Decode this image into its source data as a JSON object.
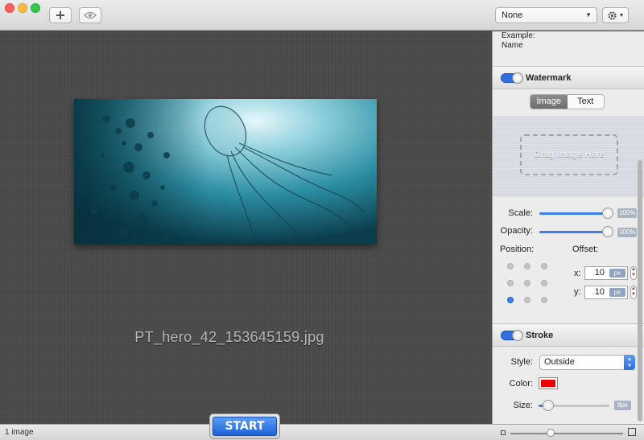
{
  "toolbar": {
    "preset_select": "None",
    "add_icon": "plus-icon",
    "preview_icon": "eye-icon",
    "settings_icon": "gear-icon"
  },
  "canvas": {
    "filename": "PT_hero_42_153645159.jpg"
  },
  "statusbar": {
    "image_count": "1 image",
    "start_label": "START"
  },
  "panel": {
    "top_text_line1": "Example:",
    "top_text_line2": "Name",
    "watermark": {
      "title": "Watermark",
      "enabled": true,
      "tab_image": "Image",
      "tab_text": "Text",
      "drop_hint": "Drag Image Here",
      "scale_label": "Scale:",
      "scale_value": "100%",
      "scale_fraction": 1.0,
      "opacity_label": "Opacity:",
      "opacity_value": "100%",
      "opacity_fraction": 1.0,
      "position_label": "Position:",
      "offset_label": "Offset:",
      "x_label": "x:",
      "x_value": "10",
      "y_label": "y:",
      "y_value": "10",
      "unit": "px",
      "selected_position": "bottom-left"
    },
    "stroke": {
      "title": "Stroke",
      "enabled": true,
      "style_label": "Style:",
      "style_value": "Outside",
      "color_label": "Color:",
      "color": "#ee0000",
      "size_label": "Size:",
      "size_value": "8px"
    }
  },
  "colors": {
    "accent": "#2f6ee0",
    "start_button": "#1d63d8"
  }
}
